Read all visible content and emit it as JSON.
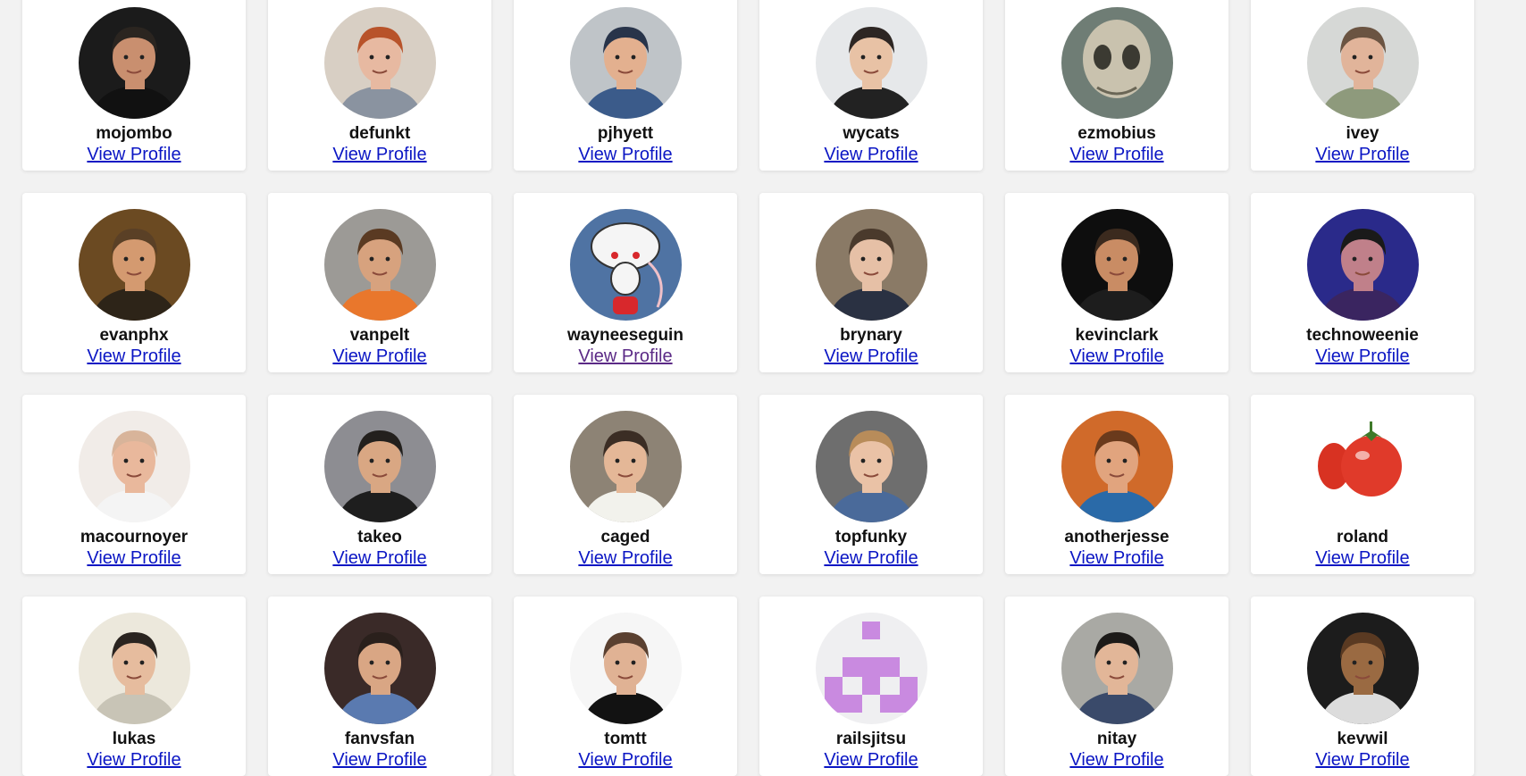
{
  "users": [
    {
      "login": "mojombo",
      "link": "View Profile",
      "bg": "#1b1b1b",
      "skin": "#c98f6f",
      "hair": "#2b2520",
      "shirt": "#111111",
      "visited": false
    },
    {
      "login": "defunkt",
      "link": "View Profile",
      "bg": "#d8cfc4",
      "skin": "#e7b9a1",
      "hair": "#b8532a",
      "shirt": "#8a93a0",
      "visited": false
    },
    {
      "login": "pjhyett",
      "link": "View Profile",
      "bg": "#bfc4c8",
      "skin": "#e3b08f",
      "hair": "#28344a",
      "shirt": "#3b5b8a",
      "visited": false
    },
    {
      "login": "wycats",
      "link": "View Profile",
      "bg": "#e6e8ea",
      "skin": "#e8c2a5",
      "hair": "#2d2623",
      "shirt": "#222222",
      "visited": false
    },
    {
      "login": "ezmobius",
      "link": "View Profile",
      "bg": "#6f7d75",
      "skin": "#c9c2ae",
      "hair": "#8f8a78",
      "shirt": "#5b6a64",
      "visited": false
    },
    {
      "login": "ivey",
      "link": "View Profile",
      "bg": "#d6d8d6",
      "skin": "#e1b49a",
      "hair": "#6b5442",
      "shirt": "#8e9a7c",
      "visited": false
    },
    {
      "login": "evanphx",
      "link": "View Profile",
      "bg": "#6b4a22",
      "skin": "#d49a70",
      "hair": "#5a4026",
      "shirt": "#2d2418",
      "visited": false
    },
    {
      "login": "vanpelt",
      "link": "View Profile",
      "bg": "#9c9a96",
      "skin": "#d7a27e",
      "hair": "#5a3a22",
      "shirt": "#e9772c",
      "visited": false
    },
    {
      "login": "wayneeseguin",
      "link": "View Profile",
      "bg": "#4f73a3",
      "skin": "#f5f5f5",
      "hair": "#f0c0c8",
      "shirt": "#d8282c",
      "visited": true
    },
    {
      "login": "brynary",
      "link": "View Profile",
      "bg": "#8a7a66",
      "skin": "#e6c0a6",
      "hair": "#4a3a2c",
      "shirt": "#2a3142",
      "visited": false
    },
    {
      "login": "kevinclark",
      "link": "View Profile",
      "bg": "#0e0e0e",
      "skin": "#c98c64",
      "hair": "#3b2a1e",
      "shirt": "#1d1d1d",
      "visited": false
    },
    {
      "login": "technoweenie",
      "link": "View Profile",
      "bg": "#2a2a8a",
      "skin": "#c0808a",
      "hair": "#1a1a1a",
      "shirt": "#3a2560",
      "visited": false
    },
    {
      "login": "macournoyer",
      "link": "View Profile",
      "bg": "#f1ece8",
      "skin": "#e9b89c",
      "hair": "#d8b49a",
      "shirt": "#f4f4f4",
      "visited": false
    },
    {
      "login": "takeo",
      "link": "View Profile",
      "bg": "#8d8d92",
      "skin": "#d9a783",
      "hair": "#23201d",
      "shirt": "#1e1e1e",
      "visited": false
    },
    {
      "login": "caged",
      "link": "View Profile",
      "bg": "#8d8375",
      "skin": "#e4b797",
      "hair": "#3b2d24",
      "shirt": "#f2f2ec",
      "visited": false
    },
    {
      "login": "topfunky",
      "link": "View Profile",
      "bg": "#6e6e6e",
      "skin": "#eac2a6",
      "hair": "#b88c5a",
      "shirt": "#4a6a9a",
      "visited": false
    },
    {
      "login": "anotherjesse",
      "link": "View Profile",
      "bg": "#d06a2a",
      "skin": "#e1a47e",
      "hair": "#6a3a1c",
      "shirt": "#2a6aa8",
      "visited": false
    },
    {
      "login": "roland",
      "link": "View Profile",
      "bg": "#ffffff",
      "skin": "#e03a2a",
      "hair": "#3f7a2a",
      "shirt": "#ffffff",
      "visited": false
    },
    {
      "login": "lukas",
      "link": "View Profile",
      "bg": "#ece8dc",
      "skin": "#e6bc9e",
      "hair": "#2a2420",
      "shirt": "#c8c4b6",
      "visited": false
    },
    {
      "login": "fanvsfan",
      "link": "View Profile",
      "bg": "#3a2a28",
      "skin": "#d9a684",
      "hair": "#2a201c",
      "shirt": "#5a7ab0",
      "visited": false
    },
    {
      "login": "tomtt",
      "link": "View Profile",
      "bg": "#f6f6f6",
      "skin": "#e0b294",
      "hair": "#5a4030",
      "shirt": "#121212",
      "visited": false
    },
    {
      "login": "railsjitsu",
      "link": "View Profile",
      "bg": "#efeff1",
      "skin": "#c98ae0",
      "hair": "#c98ae0",
      "shirt": "#c98ae0",
      "visited": false
    },
    {
      "login": "nitay",
      "link": "View Profile",
      "bg": "#a9a9a4",
      "skin": "#e2b698",
      "hair": "#1c1a18",
      "shirt": "#3a4a6a",
      "visited": false
    },
    {
      "login": "kevwil",
      "link": "View Profile",
      "bg": "#1c1c1c",
      "skin": "#9a6a42",
      "hair": "#5a3a22",
      "shirt": "#dcdcdc",
      "visited": false
    }
  ]
}
